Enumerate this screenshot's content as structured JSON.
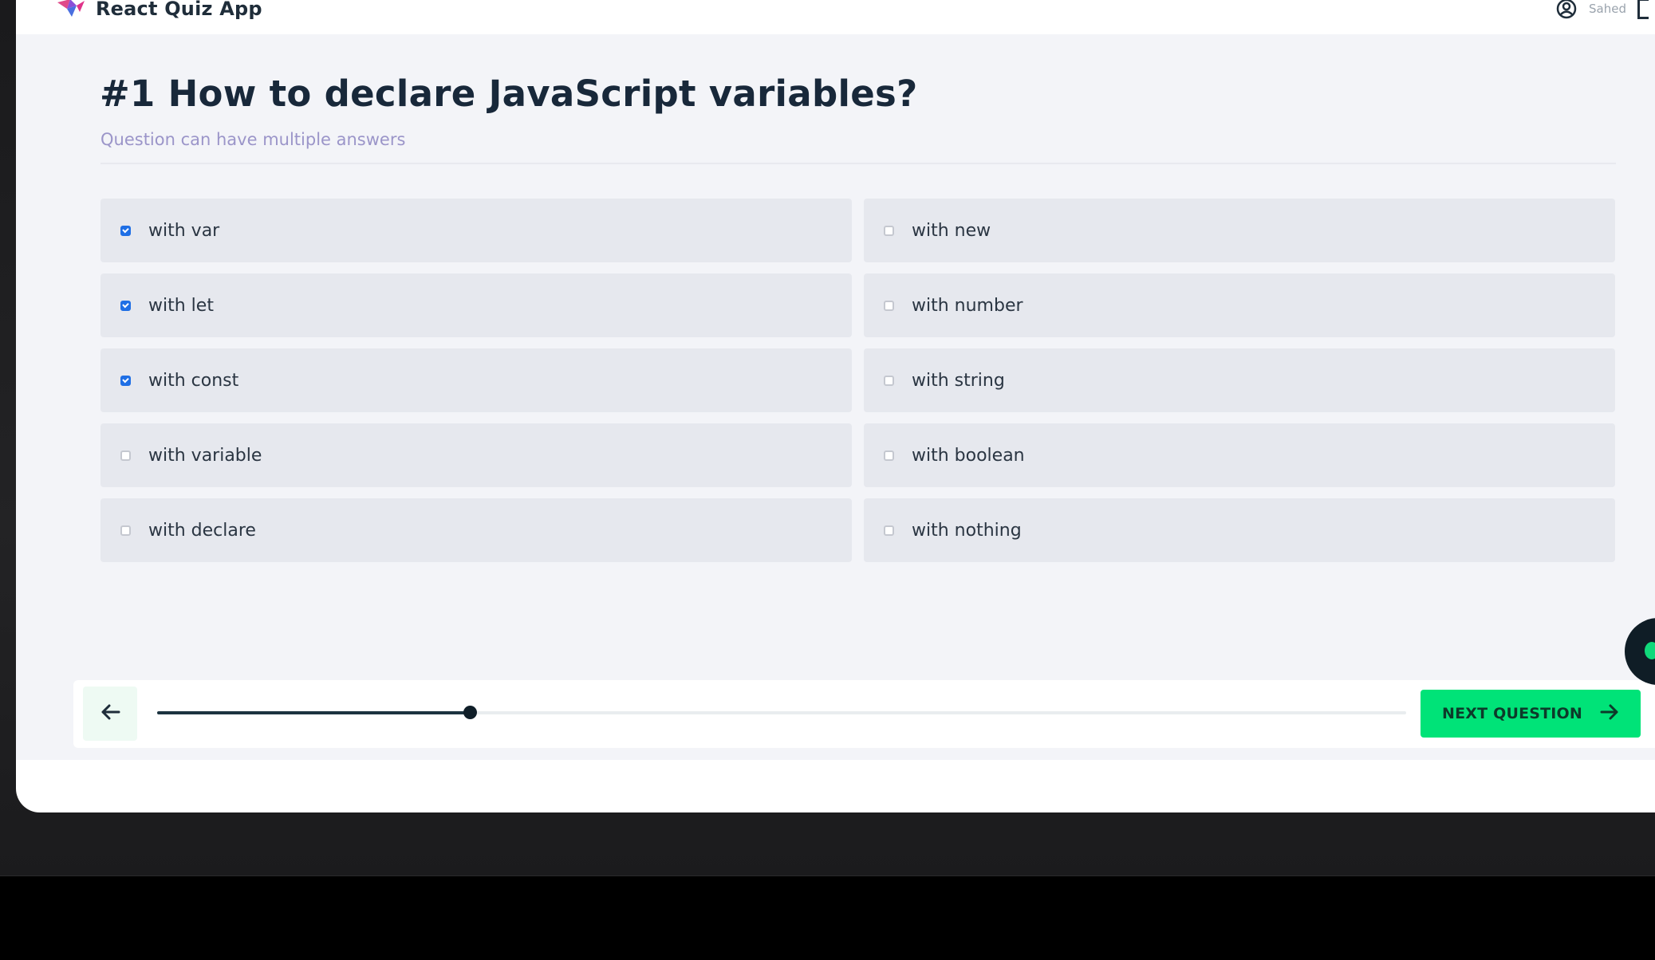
{
  "app": {
    "title": "React Quiz App"
  },
  "user": {
    "name": "Sahed"
  },
  "question": {
    "title": "#1 How to declare JavaScript variables?",
    "subtitle": "Question can have multiple answers"
  },
  "answers": [
    {
      "label": "with var",
      "checked": true
    },
    {
      "label": "with new",
      "checked": false
    },
    {
      "label": "with let",
      "checked": true
    },
    {
      "label": "with number",
      "checked": false
    },
    {
      "label": "with const",
      "checked": true
    },
    {
      "label": "with string",
      "checked": false
    },
    {
      "label": "with variable",
      "checked": false
    },
    {
      "label": "with boolean",
      "checked": false
    },
    {
      "label": "with declare",
      "checked": false
    },
    {
      "label": "with nothing",
      "checked": false
    }
  ],
  "progress": {
    "value": 0.25
  },
  "footer": {
    "next_label": "NEXT QUESTION"
  },
  "colors": {
    "accent": "#00e378",
    "checkbox_checked": "#1f6fe5",
    "subtitle": "#9b95c9",
    "title": "#18283a"
  },
  "icons": {
    "logo": "quiz-logo-icon",
    "user": "user-circle-icon",
    "back": "arrow-left-icon",
    "next": "arrow-right-icon"
  }
}
